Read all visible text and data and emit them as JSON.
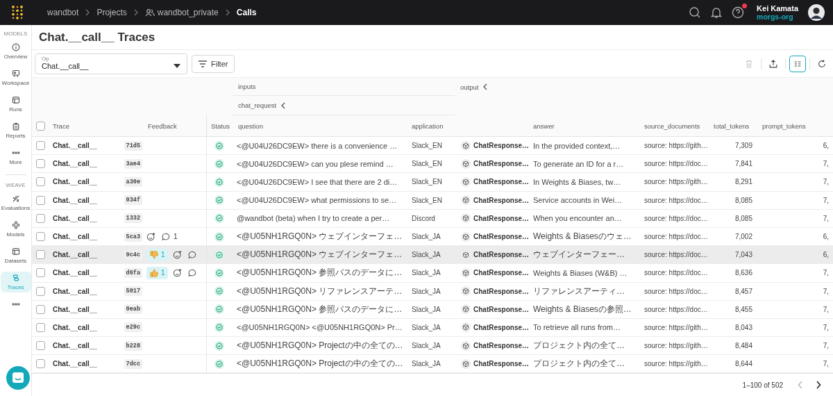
{
  "topbar": {
    "breadcrumbs": [
      {
        "label": "wandbot",
        "kind": "text"
      },
      {
        "label": "Projects",
        "kind": "text"
      },
      {
        "label": "wandbot_private",
        "kind": "team"
      },
      {
        "label": "Calls",
        "kind": "current"
      }
    ],
    "user": {
      "name": "Kei Kamata",
      "org": "morgs-org"
    },
    "help_unread": true
  },
  "sidebar": {
    "items": [
      {
        "kind": "section",
        "label": "MODELS"
      },
      {
        "kind": "overview",
        "label": "Overview",
        "selected": false
      },
      {
        "kind": "workspace",
        "label": "Workspace",
        "selected": false
      },
      {
        "kind": "runs",
        "label": "Runs",
        "selected": false
      },
      {
        "kind": "reports",
        "label": "Reports",
        "selected": false
      },
      {
        "kind": "more",
        "label": "More",
        "selected": false
      },
      {
        "kind": "divider"
      },
      {
        "kind": "section",
        "label": "WEAVE"
      },
      {
        "kind": "evaluations",
        "label": "Evaluations",
        "selected": false
      },
      {
        "kind": "models",
        "label": "Models",
        "selected": false
      },
      {
        "kind": "datasets",
        "label": "Datasets",
        "selected": false
      },
      {
        "kind": "traces",
        "label": "Traces",
        "selected": true
      },
      {
        "kind": "more",
        "selected": false
      }
    ]
  },
  "title": "Chat.__call__ Traces",
  "toolbar": {
    "op_field": {
      "label": "Op",
      "value": "Chat.__call__"
    },
    "filter_button": "Filter",
    "actions": [
      {
        "kind": "delete",
        "disabled": true,
        "active": false
      },
      {
        "kind": "export",
        "disabled": false,
        "active": false
      },
      {
        "kind": "columns",
        "disabled": false,
        "active": true
      },
      {
        "kind": "refresh",
        "disabled": false,
        "active": false
      }
    ]
  },
  "table": {
    "all_selected": false,
    "groups": {
      "inputs": "inputs",
      "chat_request": "chat_request",
      "output": "output"
    },
    "columns": {
      "trace": "Trace",
      "feedback": "Feedback",
      "status": "Status",
      "question": "question",
      "application": "application",
      "answer": "answer",
      "source_documents": "source_documents",
      "total_tokens": "total_tokens",
      "prompt_tokens": "prompt_tokens"
    },
    "rows": [
      {
        "trace": "Chat.__call__",
        "id": "71d5",
        "feedback": [],
        "succeeded": true,
        "question": "<@U04U26DC9EW> there is a convenience …",
        "application": "Slack_EN",
        "output": "ChatResponse…",
        "answer": "In the provided context,…",
        "source_documents": "source: https://gith…",
        "total_tokens": "7,309",
        "prompt_tokens": "6,",
        "highlighted": false,
        "checked": false
      },
      {
        "trace": "Chat.__call__",
        "id": "3ae4",
        "feedback": [],
        "succeeded": true,
        "question": "<@U04U26DC9EW> can you plese remind …",
        "application": "Slack_EN",
        "output": "ChatResponse…",
        "answer": "To generate an ID for a r…",
        "source_documents": "source: https://doc…",
        "total_tokens": "7,841",
        "prompt_tokens": "7,",
        "highlighted": false,
        "checked": false
      },
      {
        "trace": "Chat.__call__",
        "id": "a30e",
        "feedback": [],
        "succeeded": true,
        "question": "<@U04U26DC9EW> I see that there are 2 di…",
        "application": "Slack_EN",
        "output": "ChatResponse…",
        "answer": "In Weights & Biases, tw…",
        "source_documents": "source: https://gith…",
        "total_tokens": "8,291",
        "prompt_tokens": "7,",
        "highlighted": false,
        "checked": false
      },
      {
        "trace": "Chat.__call__",
        "id": "034f",
        "feedback": [],
        "succeeded": true,
        "question": "<@U04U26DC9EW> what permissions to se…",
        "application": "Slack_EN",
        "output": "ChatResponse…",
        "answer": "Service accounts in Wei…",
        "source_documents": "source: https://doc…",
        "total_tokens": "8,085",
        "prompt_tokens": "7,",
        "highlighted": false,
        "checked": false
      },
      {
        "trace": "Chat.__call__",
        "id": "1332",
        "feedback": [],
        "succeeded": true,
        "question": "@wandbot (beta) when I try to create a per…",
        "application": "Discord",
        "output": "ChatResponse…",
        "answer": "When you encounter an…",
        "source_documents": "source: https://doc…",
        "total_tokens": "8,085",
        "prompt_tokens": "7,",
        "highlighted": false,
        "checked": false
      },
      {
        "trace": "Chat.__call__",
        "id": "5ca3",
        "feedback": [
          {
            "kind": "add-reaction"
          },
          {
            "kind": "comments",
            "count": "1"
          }
        ],
        "succeeded": true,
        "question": "<@U05NH1RGQ0N> ウェブインターフェ…",
        "application": "Slack_JA",
        "output": "ChatResponse…",
        "answer": "Weights & Biasesのウェ…",
        "source_documents": "source: https://doc…",
        "total_tokens": "7,002",
        "prompt_tokens": "6,",
        "highlighted": false,
        "checked": false
      },
      {
        "trace": "Chat.__call__",
        "id": "9c4c",
        "feedback": [
          {
            "kind": "thumbs-down",
            "count": "1"
          },
          {
            "kind": "add-reaction"
          },
          {
            "kind": "comments"
          }
        ],
        "succeeded": true,
        "question": "<@U05NH1RGQ0N> ウェブインターフェ…",
        "application": "Slack_JA",
        "output": "ChatResponse…",
        "answer": "ウェブインターフェー…",
        "source_documents": "source: https://doc…",
        "total_tokens": "7,043",
        "prompt_tokens": "6,",
        "highlighted": true,
        "checked": false
      },
      {
        "trace": "Chat.__call__",
        "id": "d6fa",
        "feedback": [
          {
            "kind": "thumbs-up",
            "count": "1"
          },
          {
            "kind": "add-reaction"
          },
          {
            "kind": "comments"
          }
        ],
        "succeeded": true,
        "question": "<@U05NH1RGQ0N> 参照パスのデータに…",
        "application": "Slack_JA",
        "output": "ChatResponse…",
        "answer": "Weights & Biases (W&B) …",
        "source_documents": "source: https://doc…",
        "total_tokens": "8,636",
        "prompt_tokens": "7,",
        "highlighted": false,
        "checked": false
      },
      {
        "trace": "Chat.__call__",
        "id": "5017",
        "feedback": [],
        "succeeded": true,
        "question": "<@U05NH1RGQ0N> リファレンスアーテ…",
        "application": "Slack_JA",
        "output": "ChatResponse…",
        "answer": "リファレンスアーティ…",
        "source_documents": "source: https://doc…",
        "total_tokens": "8,457",
        "prompt_tokens": "7,",
        "highlighted": false,
        "checked": false
      },
      {
        "trace": "Chat.__call__",
        "id": "0eab",
        "feedback": [],
        "succeeded": true,
        "question": "<@U05NH1RGQ0N> 参照パスのデータに…",
        "application": "Slack_JA",
        "output": "ChatResponse…",
        "answer": "Weights & Biasesの参照…",
        "source_documents": "source: https://doc…",
        "total_tokens": "8,455",
        "prompt_tokens": "7,",
        "highlighted": false,
        "checked": false
      },
      {
        "trace": "Chat.__call__",
        "id": "e29c",
        "feedback": [],
        "succeeded": true,
        "question": "<@U05NH1RGQ0N> <@U05NH1RGQ0N> Pr…",
        "application": "Slack_JA",
        "output": "ChatResponse…",
        "answer": "To retrieve all runs from…",
        "source_documents": "source: https://gith…",
        "total_tokens": "8,043",
        "prompt_tokens": "7,",
        "highlighted": false,
        "checked": false
      },
      {
        "trace": "Chat.__call__",
        "id": "b228",
        "feedback": [],
        "succeeded": true,
        "question": "<@U05NH1RGQ0N> Projectの中の全ての…",
        "application": "Slack_JA",
        "output": "ChatResponse…",
        "answer": "プロジェクト内の全て…",
        "source_documents": "source: https://gith…",
        "total_tokens": "8,484",
        "prompt_tokens": "7,",
        "highlighted": false,
        "checked": false
      },
      {
        "trace": "Chat.__call__",
        "id": "7dcc",
        "feedback": [],
        "succeeded": true,
        "question": "<@U05NH1RGQ0N> Projectの中の全ての…",
        "application": "Slack_JA",
        "output": "ChatResponse…",
        "answer": "プロジェクト内の全て…",
        "source_documents": "source: https://gith…",
        "total_tokens": "8,644",
        "prompt_tokens": "7,",
        "highlighted": false,
        "checked": false
      }
    ]
  },
  "pagination": {
    "range": "1–100 of 502",
    "prev_disabled": true,
    "next_disabled": false
  }
}
